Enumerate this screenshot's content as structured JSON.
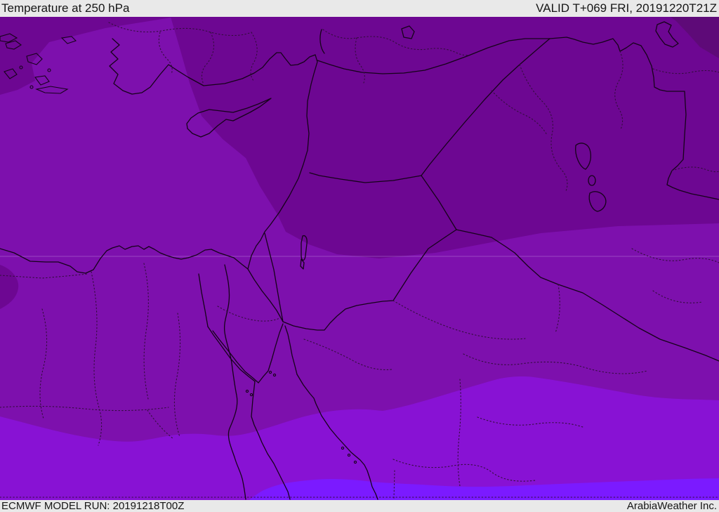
{
  "header": {
    "title": "Temperature at 250 hPa",
    "valid_time": "VALID T+069 FRI, 20191220T21Z"
  },
  "footer": {
    "model_run": "ECMWF MODEL RUN: 20191218T00Z",
    "company": "ArabiaWeather Inc."
  },
  "map": {
    "description": "ECMWF 250 hPa temperature shading over the Middle East and Eastern Mediterranean",
    "colors": {
      "band_darkest": "#5e0a78",
      "band_dark": "#6d0792",
      "band_medium": "#7d10ad",
      "band_violet": "#8812d4",
      "band_bright": "#7b1aff",
      "coastline": "#16021a",
      "admin_dotted": "#330d3d",
      "lake_fill": "#1a0020",
      "bar_bg": "#e9e9e9",
      "bar_text": "#161616"
    }
  }
}
